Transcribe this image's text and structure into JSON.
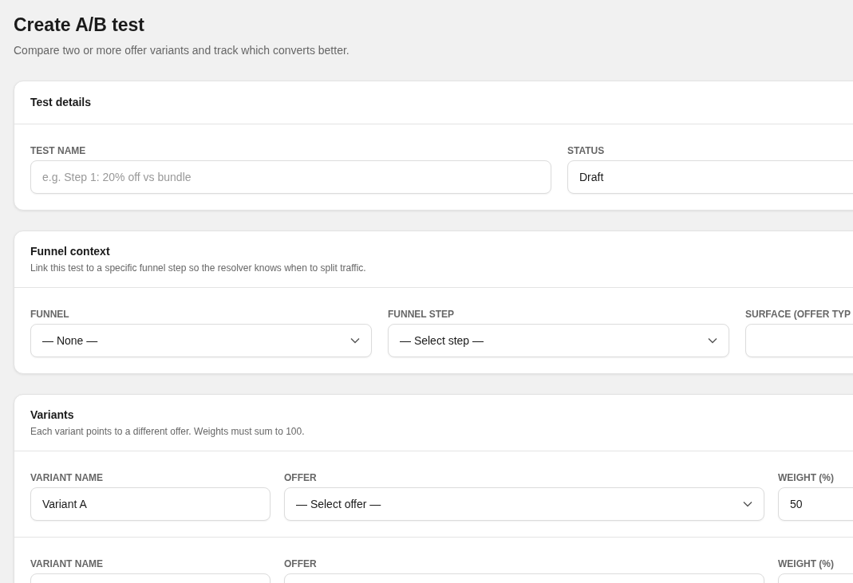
{
  "page": {
    "title": "Create A/B test",
    "subtitle": "Compare two or more offer variants and track which converts better."
  },
  "details": {
    "title": "Test details",
    "fields": [
      {
        "label": "TEST NAME",
        "kind": "input",
        "placeholder": "e.g. Step 1: 20% off vs bundle"
      },
      {
        "label": "STATUS",
        "kind": "select-cut",
        "value": "Draft"
      }
    ]
  },
  "funnel": {
    "title": "Funnel context",
    "description": "Link this test to a specific funnel step so the resolver knows when to split traffic.",
    "fields": [
      {
        "label": "FUNNEL",
        "kind": "select",
        "value": "— None —"
      },
      {
        "label": "FUNNEL STEP",
        "kind": "select",
        "value": "— Select step —"
      },
      {
        "label": "SURFACE (OFFER TYP",
        "kind": "input"
      }
    ]
  },
  "variants": {
    "title": "Variants",
    "description": "Each variant points to a different offer. Weights must sum to 100.",
    "rows": [
      {
        "name_label": "VARIANT NAME",
        "name": "Variant A",
        "offer_label": "OFFER",
        "offer": "— Select offer —",
        "weight_label": "WEIGHT (%)",
        "weight": "50"
      },
      {
        "name_label": "VARIANT NAME",
        "offer_label": "OFFER",
        "weight_label": "WEIGHT (%)"
      }
    ]
  }
}
